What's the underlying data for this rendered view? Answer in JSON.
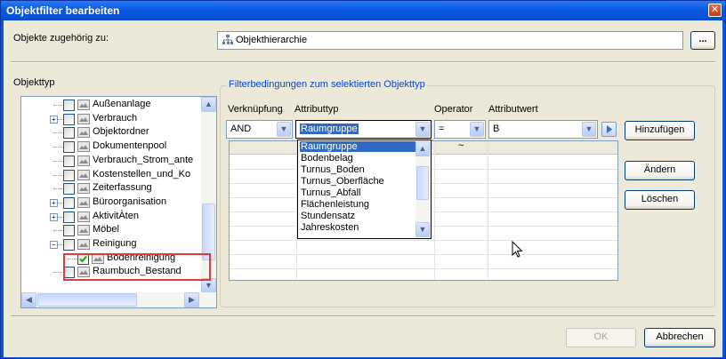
{
  "window": {
    "title": "Objektfilter bearbeiten",
    "close_glyph": "✕"
  },
  "belongs_to": {
    "label": "Objekte zugehörig zu:",
    "value": "Objekthierarchie",
    "browse_label": "..."
  },
  "object_type": {
    "label": "Objekttyp",
    "items": [
      {
        "label": "Außenanlage",
        "expander": ""
      },
      {
        "label": "Verbrauch",
        "expander": "+"
      },
      {
        "label": "Objektordner",
        "expander": ""
      },
      {
        "label": "Dokumentenpool",
        "expander": ""
      },
      {
        "label": "Verbrauch_Strom_ante",
        "expander": ""
      },
      {
        "label": "Kostenstellen_und_Ko",
        "expander": ""
      },
      {
        "label": "Zeiterfassung",
        "expander": ""
      },
      {
        "label": "Büroorganisation",
        "expander": "+"
      },
      {
        "label": "AktivitÀten",
        "expander": "+"
      },
      {
        "label": "Möbel",
        "expander": ""
      },
      {
        "label": "Reinigung",
        "expander": "−"
      },
      {
        "label": "Bodenreinigung",
        "expander": "",
        "checked": true
      },
      {
        "label": "Raumbuch_Bestand",
        "expander": ""
      }
    ]
  },
  "filter": {
    "group_title": "Filterbedingungen zum selektierten Objekttyp",
    "col_link": "Verknüpfung",
    "col_attrtype": "Attributtyp",
    "col_operator": "Operator",
    "col_value": "Attributwert",
    "link_value": "AND",
    "attrtype_value": "Raumgruppe",
    "operator_value": "=",
    "value_value": "B",
    "grid_header_mark": "~",
    "dropdown_options": [
      "Raumgruppe",
      "Bodenbelag",
      "Turnus_Boden",
      "Turnus_Oberfläche",
      "Turnus_Abfall",
      "Flächenleistung",
      "Stundensatz",
      "Jahreskosten"
    ]
  },
  "buttons": {
    "add": "Hinzufügen",
    "change": "Ändern",
    "delete": "Löschen",
    "ok": "OK",
    "cancel": "Abbrechen"
  }
}
